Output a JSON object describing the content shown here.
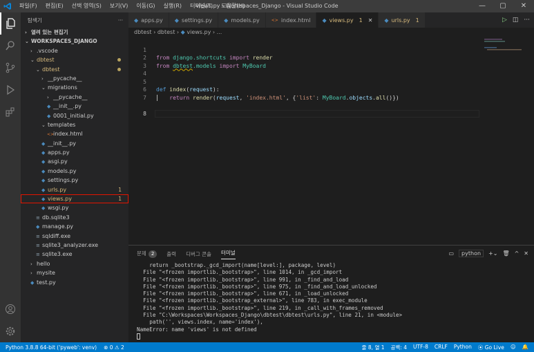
{
  "titlebar": {
    "menu": [
      "파일(F)",
      "편집(E)",
      "선택 영역(S)",
      "보기(V)",
      "이동(G)",
      "실행(R)",
      "터미널(T)",
      "도움말(H)"
    ],
    "window_title": "views.py - Workspaces_Django - Visual Studio Code"
  },
  "sidebar": {
    "title": "탐색기",
    "more": "···",
    "open_editors": "열려 있는 편집기",
    "workspace": "WORKSPACES_DJANGO",
    "tree": [
      {
        "label": ".vscode",
        "indent": 1,
        "kind": "folder-closed"
      },
      {
        "label": "dbtest",
        "indent": 1,
        "kind": "folder-open",
        "yellow": true,
        "dot": true
      },
      {
        "label": "dbtest",
        "indent": 2,
        "kind": "folder-open",
        "yellow": true,
        "dot": true
      },
      {
        "label": "__pycache__",
        "indent": 3,
        "kind": "folder-closed"
      },
      {
        "label": "migrations",
        "indent": 3,
        "kind": "folder-open"
      },
      {
        "label": "__pycache__",
        "indent": 4,
        "kind": "folder-closed"
      },
      {
        "label": "__init__.py",
        "indent": 4,
        "kind": "py"
      },
      {
        "label": "0001_initial.py",
        "indent": 4,
        "kind": "py"
      },
      {
        "label": "templates",
        "indent": 3,
        "kind": "folder-open"
      },
      {
        "label": "index.html",
        "indent": 4,
        "kind": "html"
      },
      {
        "label": "__init__.py",
        "indent": 3,
        "kind": "py"
      },
      {
        "label": "apps.py",
        "indent": 3,
        "kind": "py"
      },
      {
        "label": "asgi.py",
        "indent": 3,
        "kind": "py"
      },
      {
        "label": "models.py",
        "indent": 3,
        "kind": "py"
      },
      {
        "label": "settings.py",
        "indent": 3,
        "kind": "py"
      },
      {
        "label": "urls.py",
        "indent": 3,
        "kind": "py",
        "yellow": true,
        "badge": "1"
      },
      {
        "label": "views.py",
        "indent": 3,
        "kind": "py",
        "yellow": true,
        "badge": "1",
        "selected": true
      },
      {
        "label": "wsgi.py",
        "indent": 3,
        "kind": "py"
      },
      {
        "label": "db.sqlite3",
        "indent": 2,
        "kind": "db"
      },
      {
        "label": "manage.py",
        "indent": 2,
        "kind": "py"
      },
      {
        "label": "sqldiff.exe",
        "indent": 2,
        "kind": "exe"
      },
      {
        "label": "sqlite3_analyzer.exe",
        "indent": 2,
        "kind": "exe"
      },
      {
        "label": "sqlite3.exe",
        "indent": 2,
        "kind": "exe"
      },
      {
        "label": "hello",
        "indent": 1,
        "kind": "folder-closed"
      },
      {
        "label": "mysite",
        "indent": 1,
        "kind": "folder-closed"
      },
      {
        "label": "test.py",
        "indent": 1,
        "kind": "py"
      }
    ]
  },
  "tabs": [
    {
      "label": "apps.py",
      "icon": "py"
    },
    {
      "label": "settings.py",
      "icon": "py"
    },
    {
      "label": "models.py",
      "icon": "py"
    },
    {
      "label": "index.html",
      "icon": "html"
    },
    {
      "label": "views.py",
      "badge": "1",
      "icon": "py",
      "active": true,
      "yellow": true
    },
    {
      "label": "urls.py",
      "badge": "1",
      "icon": "py",
      "yellow": true
    }
  ],
  "breadcrumb": [
    "dbtest",
    "dbtest",
    "views.py",
    "..."
  ],
  "editor": {
    "line_numbers": [
      "1",
      "2",
      "3",
      "4",
      "5",
      "6",
      "7",
      "8"
    ],
    "current_line": "8"
  },
  "panel": {
    "tabs": [
      {
        "label": "문제",
        "count": "2"
      },
      {
        "label": "출력"
      },
      {
        "label": "디버그 콘솔"
      },
      {
        "label": "터미널",
        "active": true
      }
    ],
    "terminal_select": "python",
    "terminal_lines": [
      "    return _bootstrap._gcd_import(name[level:], package, level)",
      "  File \"<frozen importlib._bootstrap>\", line 1014, in _gcd_import",
      "  File \"<frozen importlib._bootstrap>\", line 991, in _find_and_load",
      "  File \"<frozen importlib._bootstrap>\", line 975, in _find_and_load_unlocked",
      "  File \"<frozen importlib._bootstrap>\", line 671, in _load_unlocked",
      "  File \"<frozen importlib._bootstrap_external>\", line 783, in exec_module",
      "  File \"<frozen importlib._bootstrap>\", line 219, in _call_with_frames_removed",
      "  File \"C:\\Workspaces\\Workspaces_Django\\dbtest\\dbtest\\urls.py\", line 21, in <module>",
      "    path('', views.index, name='index'),",
      "NameError: name 'views' is not defined"
    ]
  },
  "statusbar": {
    "python": "Python 3.8.8 64-bit ('pyweb': venv)",
    "problems": "⊗ 0 ⚠ 2",
    "position": "줄 8, 열 1",
    "spaces": "공백: 4",
    "encoding": "UTF-8",
    "eol": "CRLF",
    "language": "Python",
    "golive": "Go Live"
  },
  "colors": {
    "accent": "#007acc",
    "highlight": "#e51400",
    "modified": "#d7ba7d"
  }
}
